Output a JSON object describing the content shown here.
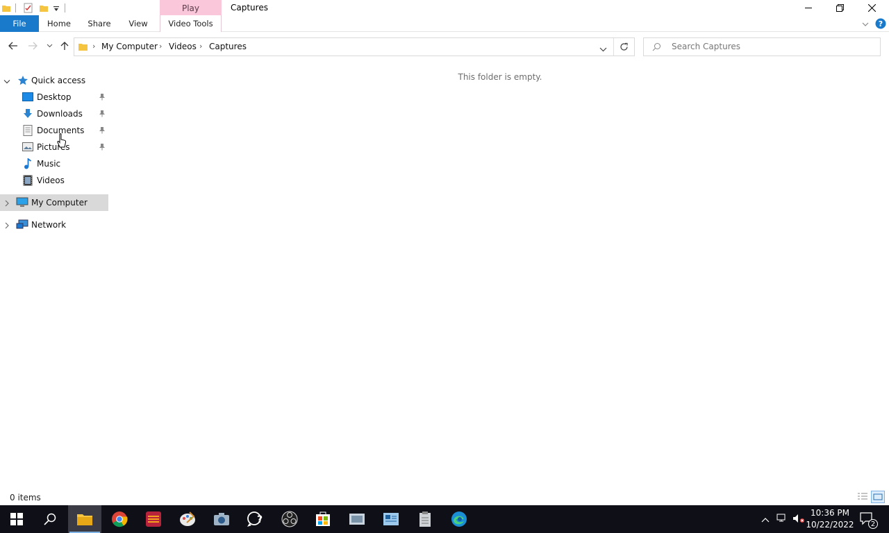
{
  "window": {
    "title": "Captures",
    "contextual_tab_label": "Play"
  },
  "ribbon": {
    "tabs": [
      "File",
      "Home",
      "Share",
      "View",
      "Video Tools"
    ]
  },
  "address": {
    "crumbs": [
      "My Computer",
      "Videos",
      "Captures"
    ]
  },
  "search": {
    "placeholder": "Search Captures"
  },
  "sidebar": {
    "quick_access_label": "Quick access",
    "items": [
      {
        "label": "Desktop",
        "icon": "desktop-icon",
        "pinned": true
      },
      {
        "label": "Downloads",
        "icon": "downloads-icon",
        "pinned": true
      },
      {
        "label": "Documents",
        "icon": "documents-icon",
        "pinned": true
      },
      {
        "label": "Pictures",
        "icon": "pictures-icon",
        "pinned": true
      },
      {
        "label": "Music",
        "icon": "music-icon",
        "pinned": false
      },
      {
        "label": "Videos",
        "icon": "videos-icon",
        "pinned": false
      }
    ],
    "my_computer_label": "My Computer",
    "network_label": "Network"
  },
  "content": {
    "empty_message": "This folder is empty."
  },
  "status": {
    "item_count": "0 items"
  },
  "taskbar": {
    "apps": [
      "start-icon",
      "search-icon",
      "file-explorer-icon",
      "chrome-icon",
      "app-icon",
      "paint-icon",
      "camera-icon",
      "help-icon",
      "obs-icon",
      "store-icon",
      "app2-icon",
      "app3-icon",
      "app4-icon",
      "edge-icon"
    ],
    "time": "10:36 PM",
    "date": "10/22/2022",
    "notification_count": "2"
  },
  "colors": {
    "accent": "#1979ca",
    "contextual_tab": "#f9c6da",
    "selected_nav": "#d9d9d9",
    "taskbar": "#0f0f17"
  }
}
